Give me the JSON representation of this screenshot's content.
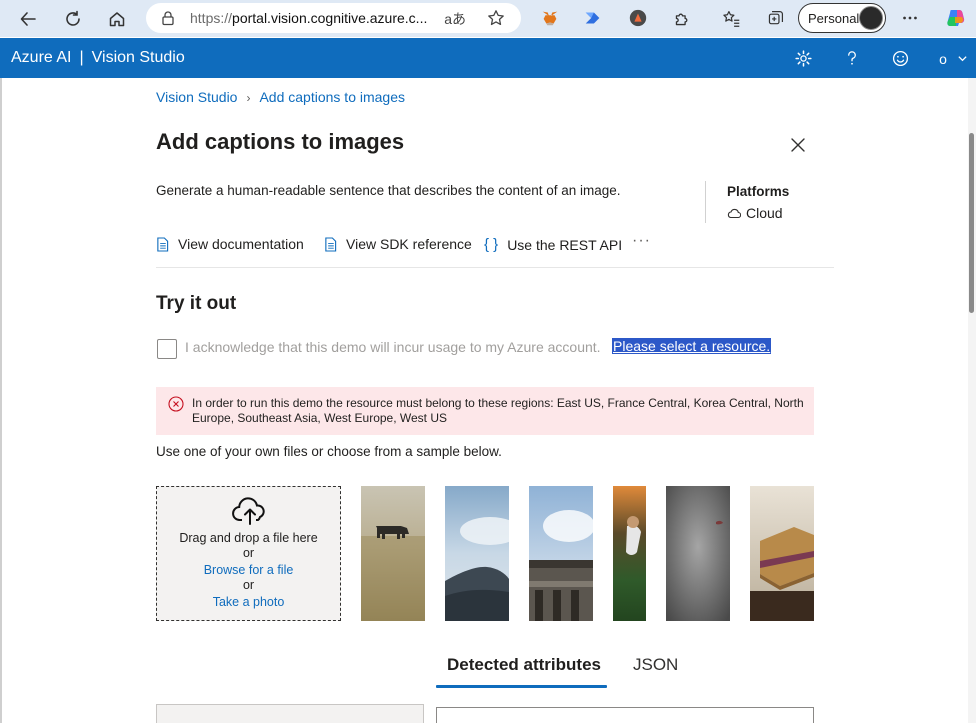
{
  "browser": {
    "url_prefix": "https://",
    "url_host": "portal.vision.cognitive.azure.c...",
    "read_aloud": "aあ",
    "profile_label": "Personal"
  },
  "header": {
    "brand": "Azure AI",
    "separator": "|",
    "product": "Vision Studio",
    "user_initial": "o"
  },
  "breadcrumb": {
    "root": "Vision Studio",
    "current": "Add captions to images"
  },
  "page": {
    "title": "Add captions to images",
    "description": "Generate a human-readable sentence that describes the content of an image.",
    "platforms_title": "Platforms",
    "platforms_value": "Cloud"
  },
  "links": {
    "docs": "View documentation",
    "sdk": "View SDK reference",
    "rest": "Use the REST API",
    "more": "···"
  },
  "try_it": {
    "title": "Try it out",
    "acknowledge": "I acknowledge that this demo will incur usage to my Azure account.",
    "select_resource": "Please select a resource."
  },
  "error": {
    "message": "In order to run this demo the resource must belong to these regions: East US, France Central, Korea Central, North Europe, Southeast Asia, West Europe, West US"
  },
  "upload": {
    "instruction": "Use one of your own files or choose from a sample below.",
    "drag_drop": "Drag and drop a file here",
    "or1": "or",
    "browse": "Browse for a file",
    "or2": "or",
    "photo": "Take a photo"
  },
  "samples": [
    "cow-in-field",
    "sky-and-rock",
    "building-facade",
    "baseball-player",
    "gray-surface",
    "sandwich"
  ],
  "tabs": {
    "detected": "Detected attributes",
    "json": "JSON"
  },
  "colors": {
    "brand_blue": "#0f6cbd",
    "error_bg": "#fde7e9",
    "error_icon": "#c50f1f",
    "selection_bg": "#2c58c8"
  }
}
